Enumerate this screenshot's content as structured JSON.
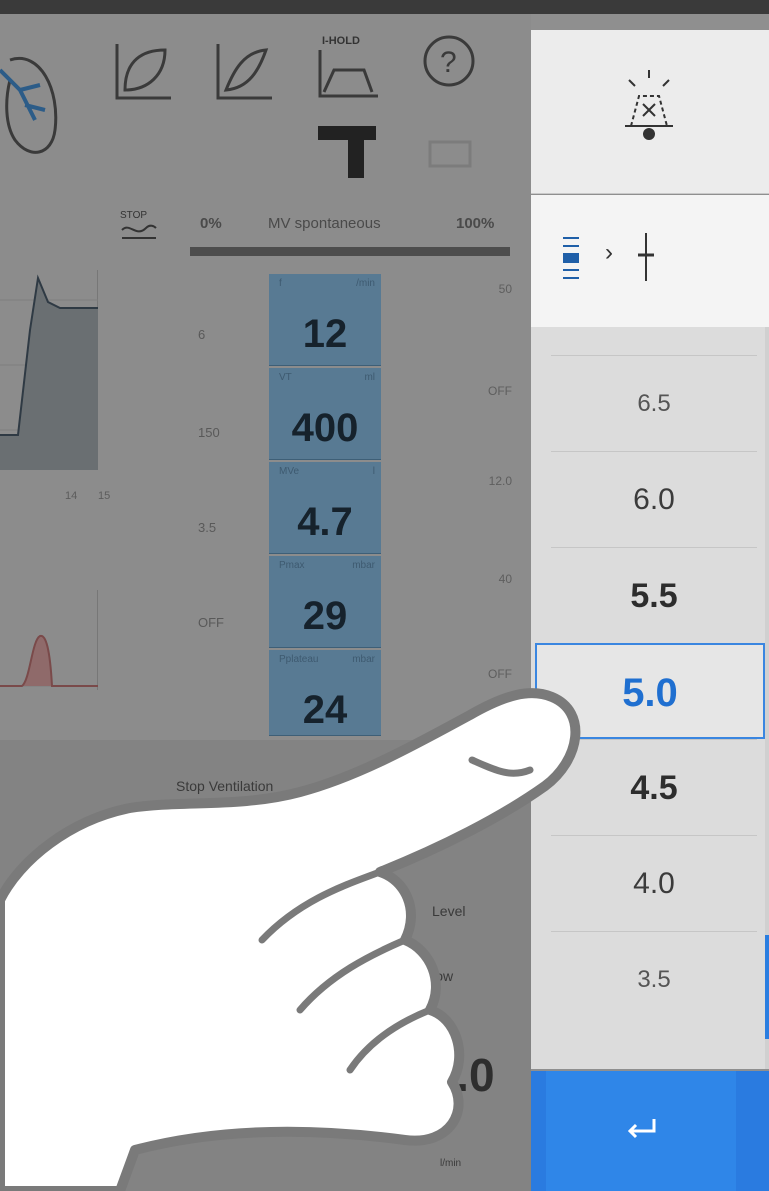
{
  "header": {
    "ihold_label": "I-HOLD",
    "help_symbol": "?",
    "stop_label": "STOP"
  },
  "mv_bar": {
    "min_label": "0%",
    "title": "MV spontaneous",
    "max_label": "100%"
  },
  "waveform": {
    "x_ticks": [
      "14",
      "15"
    ]
  },
  "left_limits": [
    "6",
    "150",
    "3.5",
    "OFF"
  ],
  "parameters": [
    {
      "name": "f",
      "unit": "/min",
      "value": "12",
      "upper_limit": "50"
    },
    {
      "name": "VT",
      "unit": "ml",
      "value": "400",
      "upper_limit": "OFF"
    },
    {
      "name": "MVe",
      "unit": "l",
      "value": "4.7",
      "upper_limit": "12.0"
    },
    {
      "name": "Pmax",
      "unit": "mbar",
      "value": "29",
      "upper_limit": "40"
    },
    {
      "name": "Pplateau",
      "unit": "mbar",
      "value": "24",
      "upper_limit": "OFF"
    }
  ],
  "lower": {
    "stop_ventilation": "Stop Ventilation",
    "flow_label_left": "Level",
    "iflow_label": "I-Flow",
    "iflow_value": "40.0",
    "iflow_unit": "l/min"
  },
  "right_panel": {
    "breadcrumb_separator": "›",
    "options": [
      "6.5",
      "6.0",
      "5.5",
      "5.0",
      "4.5",
      "4.0",
      "3.5"
    ],
    "selected": "5.0",
    "confirm_icon": "enter-icon"
  },
  "colors": {
    "accent": "#2f86e8",
    "selected_text": "#1f6fd0",
    "tile_bg": "#587a93"
  }
}
